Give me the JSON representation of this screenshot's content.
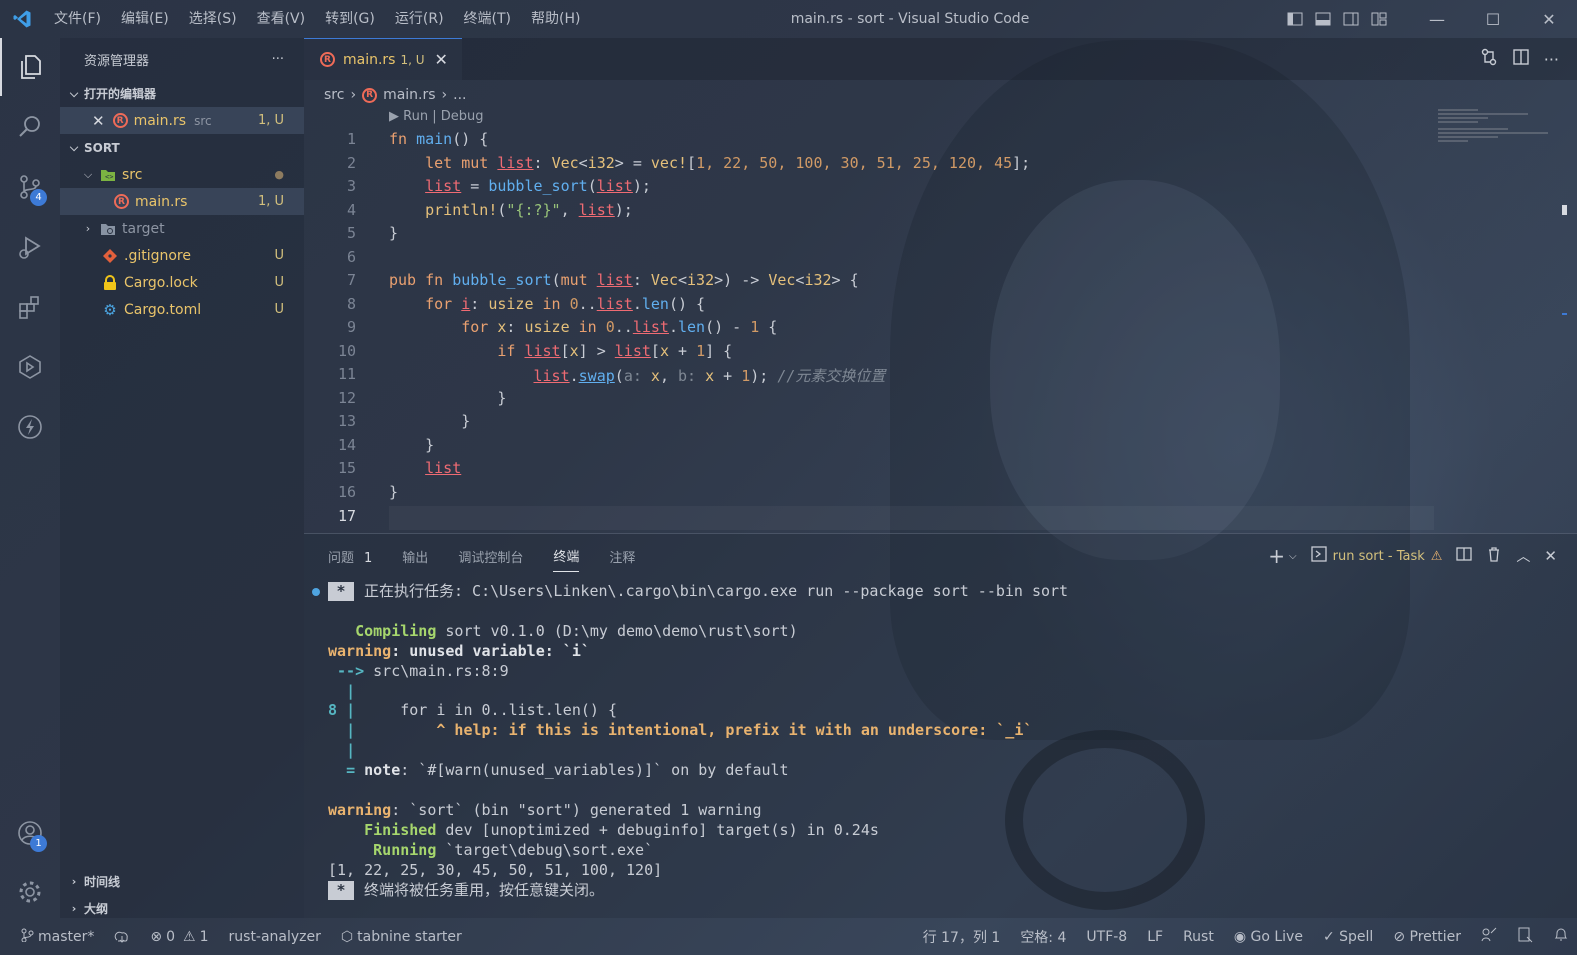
{
  "window": {
    "title": "main.rs - sort - Visual Studio Code",
    "menu": [
      "文件(F)",
      "编辑(E)",
      "选择(S)",
      "查看(V)",
      "转到(G)",
      "运行(R)",
      "终端(T)",
      "帮助(H)"
    ]
  },
  "activity": {
    "scm_badge": "4",
    "accounts_badge": "1"
  },
  "sidebar": {
    "title": "资源管理器",
    "more": "···",
    "open_editors_label": "打开的编辑器",
    "open_editor": {
      "name": "main.rs",
      "folder": "src",
      "status": "1, U"
    },
    "project_label": "SORT",
    "tree": [
      {
        "name": "src",
        "status": "●"
      },
      {
        "name": "main.rs",
        "status": "1, U"
      },
      {
        "name": "target",
        "status": ""
      },
      {
        "name": ".gitignore",
        "status": "U"
      },
      {
        "name": "Cargo.lock",
        "status": "U"
      },
      {
        "name": "Cargo.toml",
        "status": "U"
      }
    ],
    "timeline_label": "时间线",
    "outline_label": "大纲"
  },
  "editor": {
    "tab": {
      "name": "main.rs",
      "status": "1, U"
    },
    "breadcrumb": [
      "src",
      "main.rs",
      "..."
    ],
    "codelens": "▶ Run | Debug",
    "line_numbers": [
      "1",
      "2",
      "3",
      "4",
      "5",
      "6",
      "7",
      "8",
      "9",
      "10",
      "11",
      "12",
      "13",
      "14",
      "15",
      "16",
      "17"
    ],
    "code": {
      "l2_vals": "1, 22, 50, 100, 30, 51, 25, 120, 45",
      "l11_comment": "//元素交换位置"
    }
  },
  "panel": {
    "tabs": [
      "问题",
      "输出",
      "调试控制台",
      "终端",
      "注释"
    ],
    "problems_count": "1",
    "task_label": "run sort - Task",
    "terminal": {
      "line1": "正在执行任务: C:\\Users\\Linken\\.cargo\\bin\\cargo.exe run --package sort --bin sort",
      "compiling_kw": "Compiling",
      "compiling_rest": " sort v0.1.0 (D:\\my demo\\demo\\rust\\sort)",
      "warning_kw": "warning",
      "warning1_rest": ": unused variable: `i`",
      "arrow": " --> ",
      "location": "src\\main.rs:8:9",
      "line_no": "8",
      "src_line": "     for i in 0..list.len() {",
      "help": "         ^ help: if this is intentional, prefix it with an underscore: `_i`",
      "note_kw": "note",
      "note_rest": ": `#[warn(unused_variables)]` on by default",
      "warning2_rest": ": `sort` (bin \"sort\") generated 1 warning",
      "finished_kw": "Finished",
      "finished_rest": " dev [unoptimized + debuginfo] target(s) in 0.24s",
      "running_kw": "Running",
      "running_rest": " `target\\debug\\sort.exe`",
      "output": "[1, 22, 25, 30, 45, 50, 51, 100, 120]",
      "reuse": "终端将被任务重用，按任意键关闭。"
    }
  },
  "statusbar": {
    "branch": "master*",
    "errors": "0",
    "warnings": "1",
    "rust_analyzer": "rust-analyzer",
    "tabnine": "tabnine starter",
    "position": "行 17，列 1",
    "spaces": "空格: 4",
    "encoding": "UTF-8",
    "eol": "LF",
    "language": "Rust",
    "golive": "Go Live",
    "spell": "Spell",
    "prettier": "Prettier"
  },
  "colors": {
    "accent": "#3d7ad6",
    "untracked": "#d3c07d",
    "rust_icon": "#ef6b58"
  }
}
